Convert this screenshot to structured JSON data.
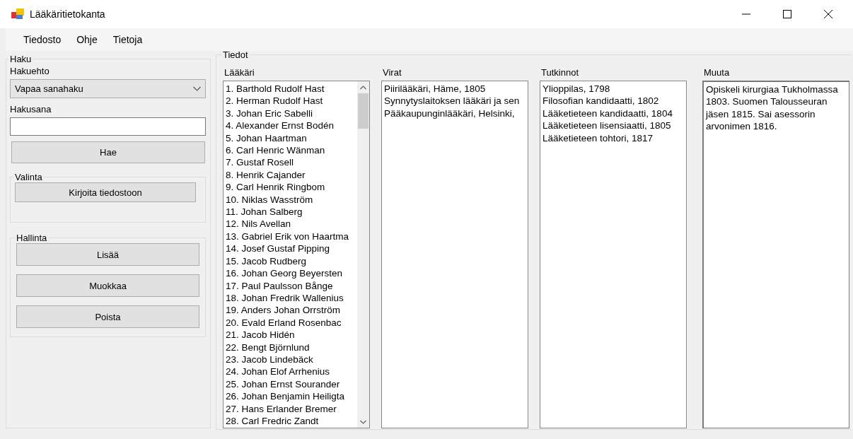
{
  "window": {
    "title": "Lääkäritietokanta"
  },
  "menu": [
    "Tiedosto",
    "Ohje",
    "Tietoja"
  ],
  "search_group": {
    "title": "Haku",
    "criterion_label": "Hakuehto",
    "criterion_value": "Vapaa sanahaku",
    "term_label": "Hakusana",
    "search_button": "Hae"
  },
  "selection_group": {
    "title": "Valinta",
    "buttons": [
      "Kirjoita tiedostoon"
    ]
  },
  "management_group": {
    "title": "Hallinta",
    "buttons": [
      "Lisää",
      "Muokkaa",
      "Poista"
    ]
  },
  "details": {
    "title": "Tiedot",
    "doctors": {
      "label": "Lääkäri",
      "items": [
        "1. Barthold Rudolf Hast",
        "2. Herman Rudolf Hast",
        "3. Johan Eric Sabelli",
        "4. Alexander Ernst Bodén",
        "5. Johan Haartman",
        "6. Carl Henric Wänman",
        "7. Gustaf Rosell",
        "8. Henrik Cajander",
        "9. Carl Henrik Ringbom",
        "10. Niklas Wasström",
        "11. Johan Salberg",
        "12. Nils Avellan",
        "13. Gabriel Erik von Haartma",
        "14. Josef Gustaf Pipping",
        "15. Jacob Rudberg",
        "16. Johan Georg Beyersten",
        "17. Paul Paulsson Bånge",
        "18. Johan Fredrik Wallenius",
        "19. Anders Johan Orrström",
        "20. Evald Erland Rosenbac",
        "21. Jacob Hidén",
        "22. Bengt Björnlund",
        "23. Jacob Lindebäck",
        "24. Johan Elof Arrhenius",
        "25. Johan Ernst Sourander",
        "26. Johan Benjamin Heiligta",
        "27. Hans Erlander Bremer",
        "28. Carl Fredric Zandt"
      ]
    },
    "offices": {
      "label": "Virat",
      "items": [
        "Piirilääkäri, Häme, 1805",
        "Synnytyslaitoksen lääkäri ja sen",
        "Pääkaupunginlääkäri, Helsinki,"
      ]
    },
    "degrees": {
      "label": "Tutkinnot",
      "items": [
        "Ylioppilas, 1798",
        "Filosofian kandidaatti, 1802",
        "Lääketieteen kandidaatti, 1804",
        "Lääketieteen lisensiaatti, 1805",
        "Lääketieteen tohtori, 1817"
      ]
    },
    "other": {
      "label": "Muuta",
      "text": "Opiskeli kirurgiaa Tukholmassa 1803. Suomen Talousseuran jäsen 1815. Sai asessorin arvonimen 1816."
    }
  }
}
